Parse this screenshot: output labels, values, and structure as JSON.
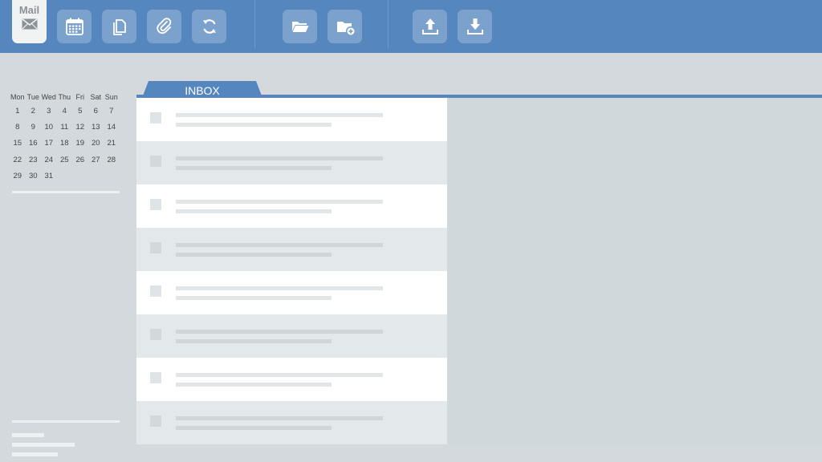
{
  "toolbar": {
    "mail_label": "Mail",
    "buttons": [
      {
        "name": "calendar",
        "icon": "calendar-icon"
      },
      {
        "name": "copy",
        "icon": "copy-icon"
      },
      {
        "name": "attach",
        "icon": "paperclip-icon"
      },
      {
        "name": "sync",
        "icon": "sync-icon"
      },
      {
        "name": "open-folder",
        "icon": "folder-open-icon"
      },
      {
        "name": "new-folder",
        "icon": "folder-add-icon"
      },
      {
        "name": "upload",
        "icon": "upload-icon"
      },
      {
        "name": "download",
        "icon": "download-icon"
      }
    ]
  },
  "calendar": {
    "days": [
      "Mon",
      "Tue",
      "Wed",
      "Thu",
      "Fri",
      "Sat",
      "Sun"
    ],
    "weeks": [
      [
        "1",
        "2",
        "3",
        "4",
        "5",
        "6",
        "7"
      ],
      [
        "8",
        "9",
        "10",
        "11",
        "12",
        "13",
        "14"
      ],
      [
        "15",
        "16",
        "17",
        "18",
        "19",
        "20",
        "21"
      ],
      [
        "22",
        "23",
        "24",
        "25",
        "26",
        "27",
        "28"
      ],
      [
        "29",
        "30",
        "31",
        "",
        "",
        "",
        ""
      ]
    ]
  },
  "inbox": {
    "tab_label": "INBOX",
    "message_count": 8
  },
  "colors": {
    "toolbar": "#5586bd",
    "button": "#7ba2cd",
    "background": "#d3d9dc"
  }
}
